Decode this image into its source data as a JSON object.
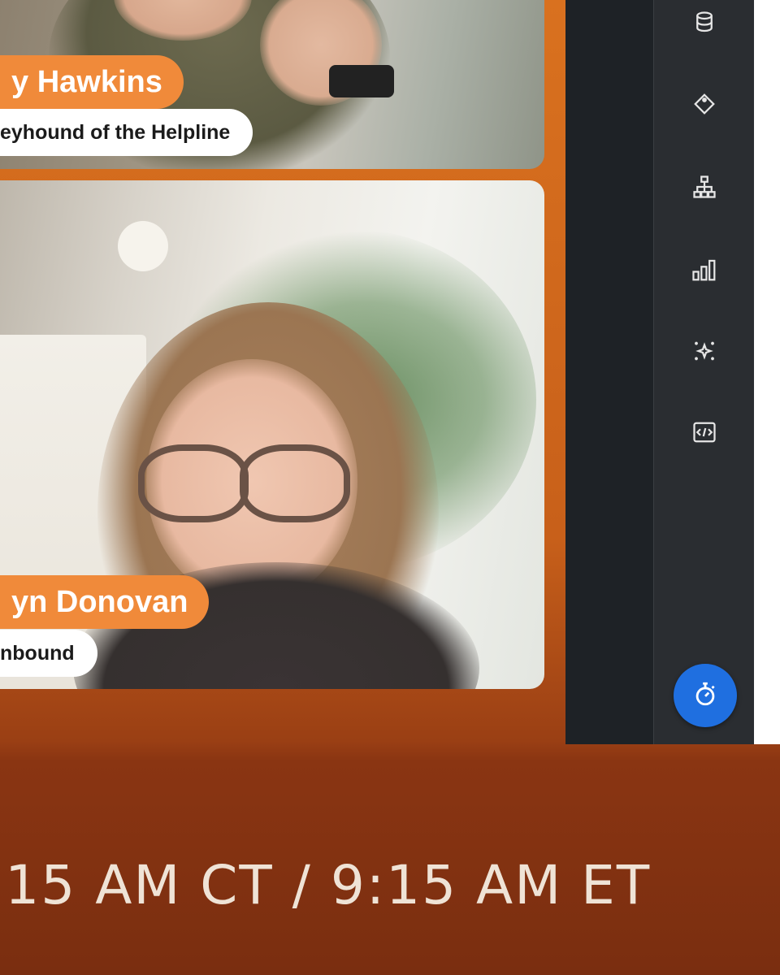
{
  "participants": [
    {
      "name": "y Hawkins",
      "role": "eyhound of the Helpline"
    },
    {
      "name": "yn Donovan",
      "role": "nbound"
    }
  ],
  "sidebar": {
    "icons": [
      "database-icon",
      "tag-icon",
      "hierarchy-icon",
      "bar-chart-icon",
      "sparkle-icon",
      "code-icon"
    ],
    "timer_icon": "stopwatch-icon",
    "accent": "#1f6fe0"
  },
  "banner": {
    "time_text": ":15 AM CT / 9:15 AM ET"
  },
  "colors": {
    "brand_orange": "#f08a3a",
    "background_orange": "#d86a1e"
  }
}
